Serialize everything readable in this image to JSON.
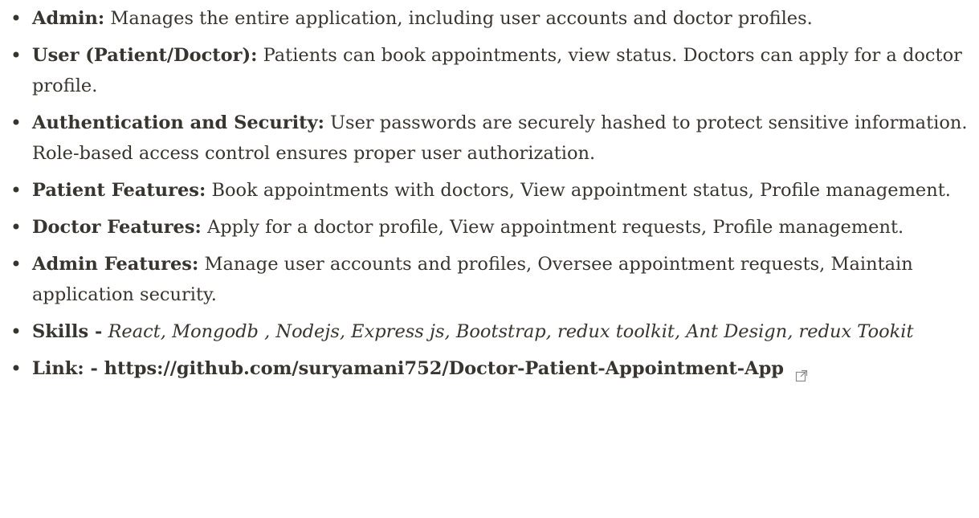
{
  "items": [
    {
      "label": "Admin:",
      "text": "Manages the entire application, including user accounts and doctor profiles."
    },
    {
      "label": "User (Patient/Doctor):",
      "text": "Patients can book appointments, view status. Doctors can apply for a doctor profile."
    },
    {
      "label": "Authentication and Security:",
      "text": "User passwords are securely hashed to protect sensitive information. Role-based access control ensures proper user authorization."
    },
    {
      "label": "Patient Features:",
      "text": "Book appointments with doctors, View appointment status, Profile management."
    },
    {
      "label": "Doctor Features:",
      "text": "Apply for a doctor profile, View appointment requests, Profile management."
    },
    {
      "label": "Admin Features:",
      "text": "Manage user accounts and profiles, Oversee appointment requests, Maintain application security."
    }
  ],
  "skills": {
    "label": "Skills -",
    "text": "React, Mongodb , Nodejs, Express js, Bootstrap, redux toolkit, Ant Design, redux Tookit"
  },
  "link": {
    "label": "Link: -",
    "url": "https://github.com/suryamani752/Doctor-Patient-Appointment-App",
    "icon": "external-link-icon"
  },
  "bullet_char": "•"
}
